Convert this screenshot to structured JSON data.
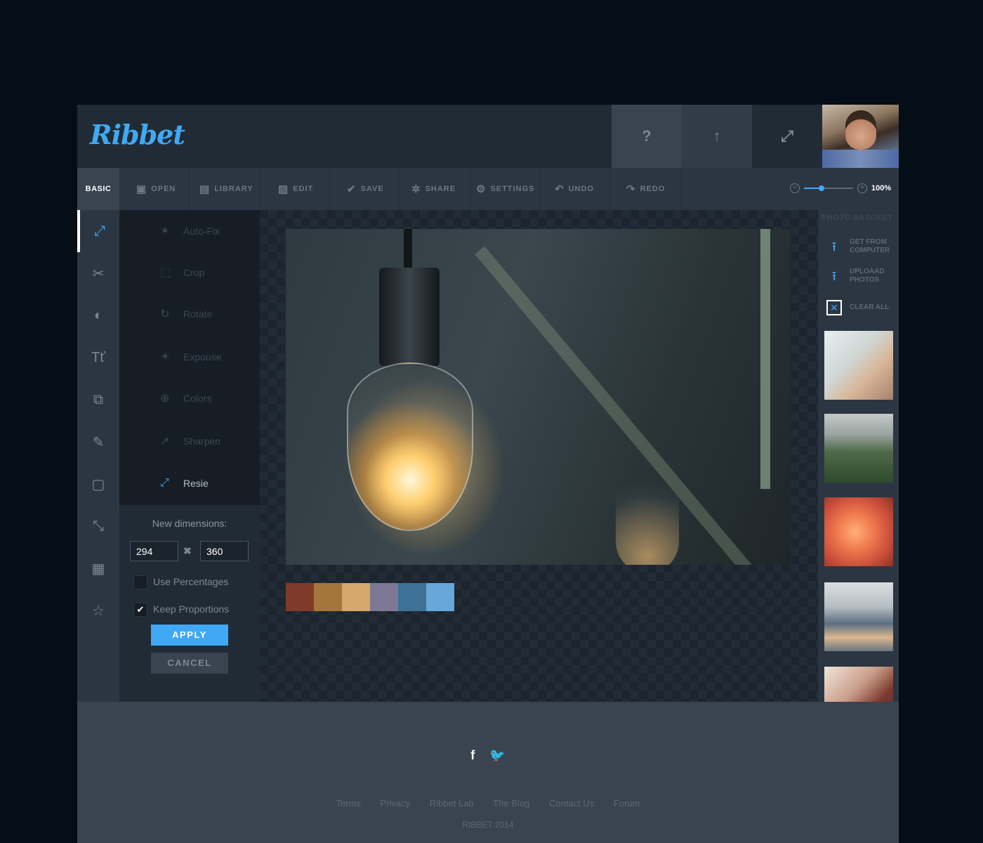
{
  "app": {
    "logo": "Ribbet"
  },
  "header": {
    "help_icon": "?",
    "upload_icon": "↑",
    "expand_icon": "⤢"
  },
  "toolbar": {
    "basic_label": "BASIC",
    "items": [
      {
        "icon": "▣",
        "label": "OPEN"
      },
      {
        "icon": "▤",
        "label": "LIBRARY"
      },
      {
        "icon": "▨",
        "label": "EDIT"
      },
      {
        "icon": "✔",
        "label": "SAVE"
      },
      {
        "icon": "✲",
        "label": "SHARE"
      },
      {
        "icon": "⚙",
        "label": "SETTINGS"
      },
      {
        "icon": "↶",
        "label": "UNDO"
      },
      {
        "icon": "↷",
        "label": "REDO"
      }
    ],
    "zoom": {
      "minus_icon": "−",
      "plus_icon": "+",
      "value": "100%",
      "slider_fraction": 0.35
    }
  },
  "sidebar": {
    "icons": [
      "⤢",
      "✂",
      "◐",
      "Tť",
      "⧉",
      "✎",
      "▢",
      "⤡",
      "▦",
      "☆"
    ]
  },
  "tools": {
    "items": [
      {
        "icon": "✶",
        "label": "Auto-Fix"
      },
      {
        "icon": "⬚",
        "label": "Crop"
      },
      {
        "icon": "↻",
        "label": "Rotate"
      },
      {
        "icon": "☀",
        "label": "Expouse"
      },
      {
        "icon": "⊕",
        "label": "Colors"
      },
      {
        "icon": "↗",
        "label": "Sharpen"
      },
      {
        "icon": "⤢",
        "label": "Resie"
      }
    ]
  },
  "resize": {
    "title": "New dimensions:",
    "width": "294",
    "height": "360",
    "times": "✖",
    "use_percentages": "Use Percentages",
    "keep_proportions": "Keep Proportions",
    "check_mark": "✔",
    "apply": "APPLY",
    "cancel": "CANCEL"
  },
  "palette": [
    "#7e3b2a",
    "#a3763b",
    "#d4a86a",
    "#7d7893",
    "#3d7296",
    "#68a8d8"
  ],
  "colors": {
    "accent": "#3fa9f5",
    "header_bg": "#212b35",
    "panel_bg": "#2c3642",
    "footer_bg": "#3a4450"
  },
  "basket": {
    "title": "PHOTO BASCKET",
    "actions": [
      {
        "icon": "⭱",
        "label": "GET FROM COMPUTER"
      },
      {
        "icon": "⭱",
        "label": "UPLOAAD PHOTOS"
      },
      {
        "icon": "✕",
        "label": "CLEAR ALL"
      }
    ]
  },
  "footer": {
    "social": [
      "f",
      "🐦"
    ],
    "links": [
      "Terms",
      "Privacy",
      "Ribbet Lab",
      "The Blog",
      "Contact Us",
      "Forum"
    ],
    "copyright": "RIBBET 2014"
  }
}
